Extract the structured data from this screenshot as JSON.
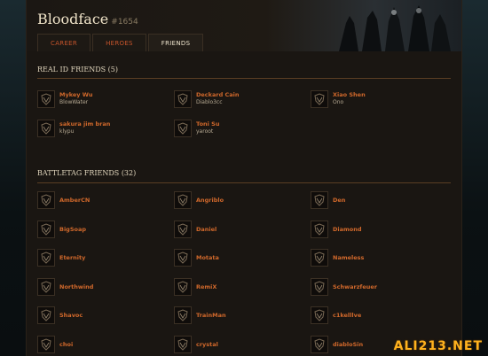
{
  "header": {
    "title": "Bloodface",
    "tag": "#1654"
  },
  "tabs": [
    {
      "label": "CAREER",
      "active": false
    },
    {
      "label": "HEROES",
      "active": false
    },
    {
      "label": "FRIENDS",
      "active": true
    }
  ],
  "real_id": {
    "heading": "REAL ID FRIENDS (5)",
    "friends": [
      {
        "name": "Mykey Wu",
        "sub": "BlowWater"
      },
      {
        "name": "Deckard Cain",
        "sub": "Diablo3cc"
      },
      {
        "name": "Xiao Shen",
        "sub": "Ono"
      },
      {
        "name": "sakura jim bran",
        "sub": "klypu"
      },
      {
        "name": "Toni Su",
        "sub": "yaroot"
      }
    ]
  },
  "battletag": {
    "heading": "BATTLETAG FRIENDS (32)",
    "friends": [
      {
        "name": "AmberCN"
      },
      {
        "name": "Angriblo"
      },
      {
        "name": "Den"
      },
      {
        "name": "BigSoap"
      },
      {
        "name": "Daniel"
      },
      {
        "name": "Diamond"
      },
      {
        "name": "Eternity"
      },
      {
        "name": "Motata"
      },
      {
        "name": "Nameless"
      },
      {
        "name": "Northwind"
      },
      {
        "name": "RemiX"
      },
      {
        "name": "Schwarzfeuer"
      },
      {
        "name": "Shavoc"
      },
      {
        "name": "TrainMan"
      },
      {
        "name": "c1kelllve"
      },
      {
        "name": "choi"
      },
      {
        "name": "crystal"
      },
      {
        "name": "diabloSin"
      }
    ]
  },
  "icons": {
    "avatar": "demon-crest-icon"
  },
  "colors": {
    "accent": "#d0682b",
    "background": "#1a1612",
    "rule": "#5a3e24"
  },
  "watermark": "ALI213.NET"
}
